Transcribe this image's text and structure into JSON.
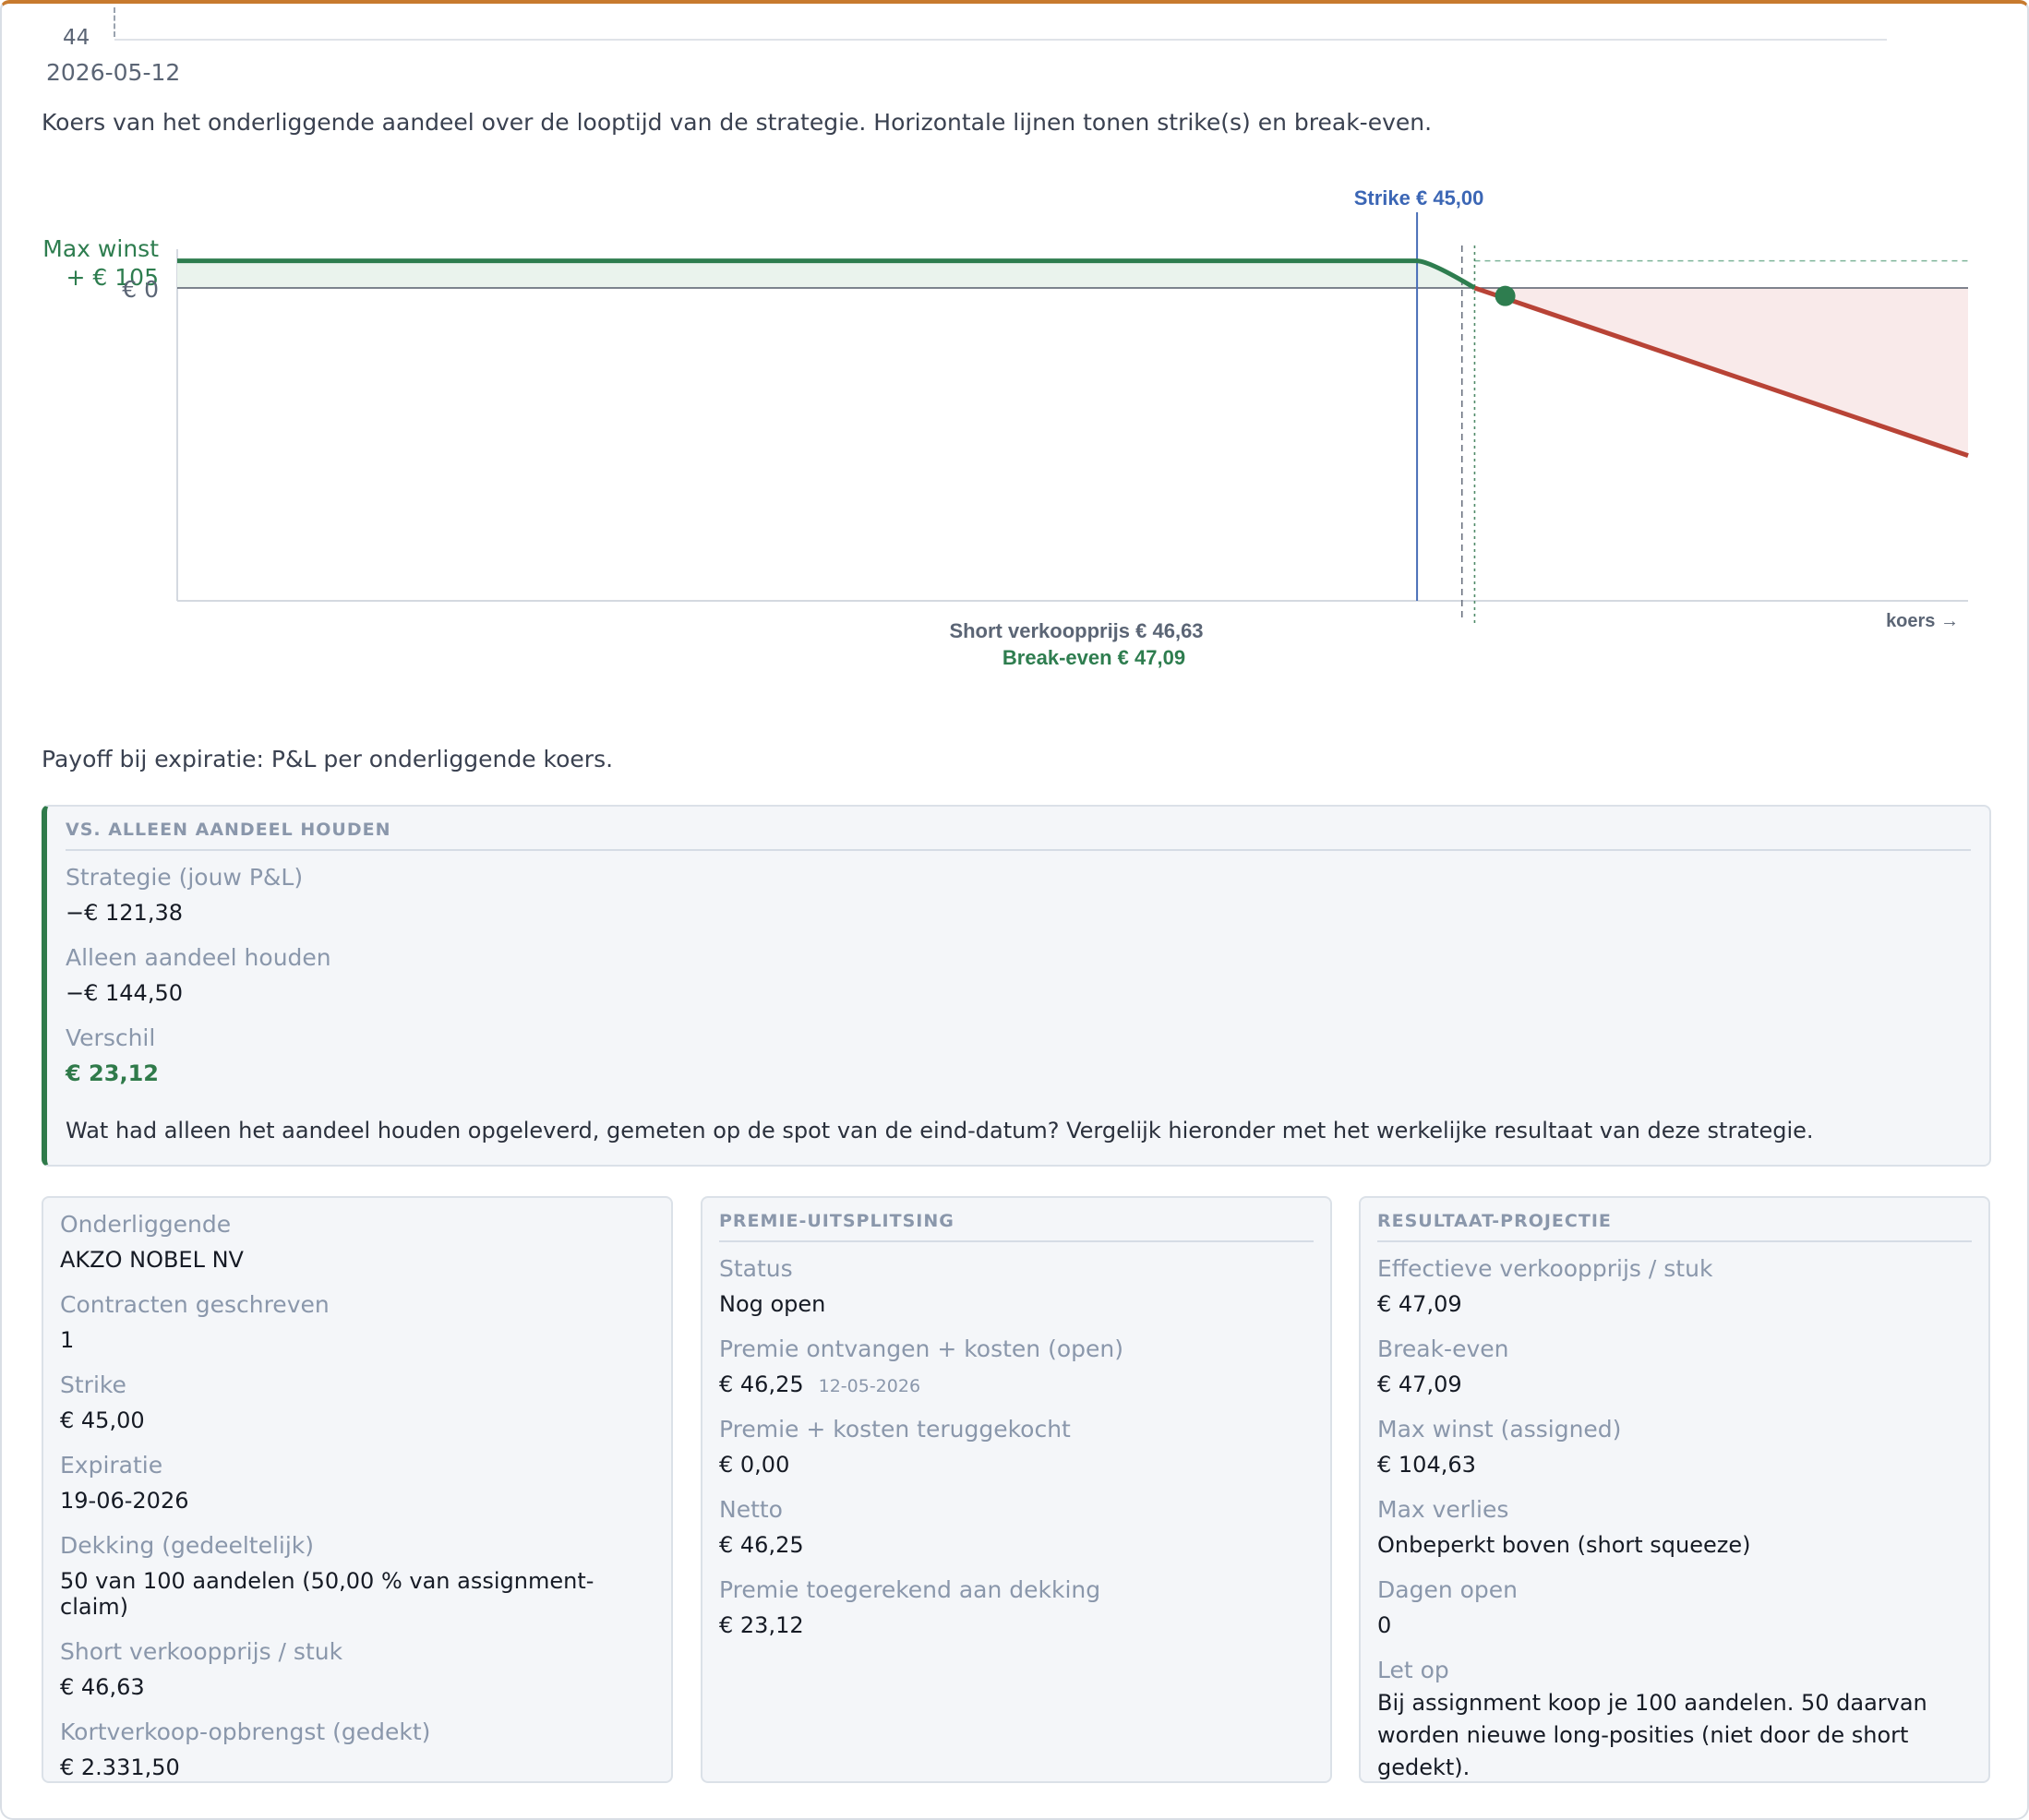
{
  "price_chart": {
    "y_tick": "44",
    "x_tick": "2026-05-12",
    "caption": "Koers van het onderliggende aandeel over de looptijd van de strategie. Horizontale lijnen tonen strike(s) en break-even."
  },
  "chart_data": {
    "type": "line",
    "title": "",
    "xlabel": "koers →",
    "ylabel": "",
    "series": [
      {
        "points": [
          [
            0,
            105
          ],
          [
            45.0,
            105
          ],
          [
            45.5,
            102
          ],
          [
            47.09,
            0
          ],
          [
            48.2,
            -31
          ],
          [
            65,
            -650
          ]
        ]
      }
    ],
    "marker_labels": {
      "strike": "Strike € 45,00",
      "short_price": "Short verkoopprijs € 46,63",
      "break_even": "Break-even € 47,09",
      "max_profit_line1": "Max winst",
      "max_profit_line2": "+ € 105",
      "zero": "€ 0"
    },
    "strike": 45.0,
    "short_price": 46.63,
    "break_even": 47.09,
    "max_profit": 105,
    "current_spot": 48.2,
    "current_pnl": -31,
    "colors": {
      "profit": "#2e7d4f",
      "loss": "#b84336",
      "strike": "#3b66b5"
    }
  },
  "payoff_caption": "Payoff bij expiratie: P&L per onderliggende koers.",
  "vs": {
    "title": "VS. ALLEEN AANDEEL HOUDEN",
    "strategy_label": "Strategie (jouw P&L)",
    "strategy_value": "−€ 121,38",
    "hold_label": "Alleen aandeel houden",
    "hold_value": "−€ 144,50",
    "diff_label": "Verschil",
    "diff_value": "€ 23,12",
    "note": "Wat had alleen het aandeel houden opgeleverd, gemeten op de spot van de eind-datum? Vergelijk hieronder met het werkelijke resultaat van deze strategie."
  },
  "details": [
    {
      "label": "Onderliggende",
      "value": "AKZO NOBEL NV"
    },
    {
      "label": "Contracten geschreven",
      "value": "1"
    },
    {
      "label": "Strike",
      "value": "€ 45,00"
    },
    {
      "label": "Expiratie",
      "value": "19-06-2026"
    },
    {
      "label": "Dekking (gedeeltelijk)",
      "value": "50 van 100 aandelen (50,00 % van assignment-claim)"
    },
    {
      "label": "Short verkoopprijs / stuk",
      "value": "€ 46,63"
    },
    {
      "label": "Kortverkoop-opbrengst (gedekt)",
      "value": "€ 2.331,50"
    }
  ],
  "premium": {
    "title": "PREMIE-UITSPLITSING",
    "items": [
      {
        "label": "Status",
        "value": "Nog open"
      },
      {
        "label": "Premie ontvangen + kosten (open)",
        "value": "€ 46,25",
        "date": "12-05-2026"
      },
      {
        "label": "Premie + kosten teruggekocht",
        "value": "€ 0,00"
      },
      {
        "label": "Netto",
        "value": "€ 46,25"
      },
      {
        "label": "Premie toegerekend aan dekking",
        "value": "€ 23,12"
      }
    ]
  },
  "projection": {
    "title": "RESULTAAT-PROJECTIE",
    "items": [
      {
        "label": "Effectieve verkoopprijs / stuk",
        "value": "€ 47,09"
      },
      {
        "label": "Break-even",
        "value": "€ 47,09"
      },
      {
        "label": "Max winst (assigned)",
        "value": "€ 104,63"
      },
      {
        "label": "Max verlies",
        "value": "Onbeperkt boven (short squeeze)"
      },
      {
        "label": "Dagen open",
        "value": "0"
      },
      {
        "label": "Let op",
        "value": "Bij assignment koop je 100 aandelen. 50 daarvan worden nieuwe long-posities (niet door de short gedekt)."
      }
    ]
  }
}
